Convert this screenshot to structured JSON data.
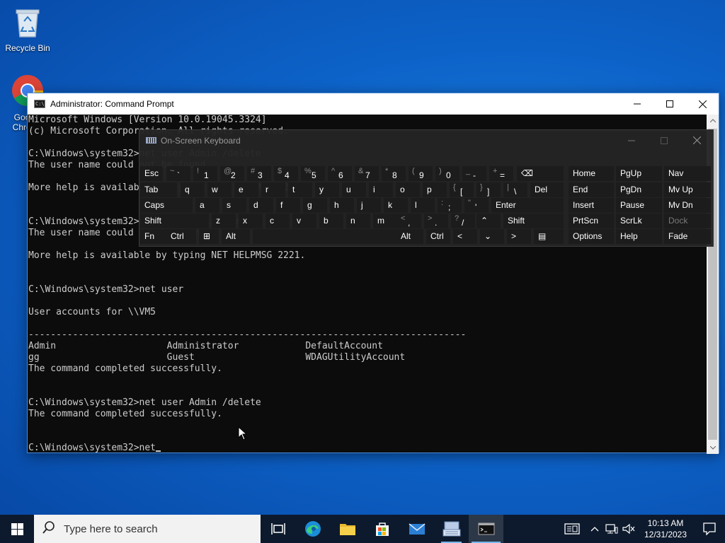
{
  "desktop": {
    "icons": [
      {
        "label": "Recycle Bin"
      },
      {
        "label": "Google Chrome"
      }
    ]
  },
  "cmd": {
    "title": "Administrator: Command Prompt",
    "lines": [
      "Microsoft Windows [Version 10.0.19045.3324]",
      "(c) Microsoft Corporation. All rights reserved.",
      "",
      "C:\\Windows\\system32>net user Admin /delete",
      "The user name could not be found.",
      "",
      "More help is available by typing NET HELPMSG 2221.",
      "",
      "",
      "C:\\Windows\\system32>net user Admin /delete",
      "The user name could not be found.",
      "",
      "More help is available by typing NET HELPMSG 2221.",
      "",
      "",
      "C:\\Windows\\system32>net user",
      "",
      "User accounts for \\\\VM5",
      "",
      "-------------------------------------------------------------------------------",
      "Admin                    Administrator            DefaultAccount",
      "gg                       Guest                    WDAGUtilityAccount",
      "The command completed successfully.",
      "",
      "",
      "C:\\Windows\\system32>net user Admin /delete",
      "The command completed successfully.",
      "",
      "",
      "C:\\Windows\\system32>net"
    ]
  },
  "osk": {
    "title": "On-Screen Keyboard",
    "row1": [
      {
        "label": "Esc"
      },
      {
        "top": "~",
        "bot": "`"
      },
      {
        "top": "!",
        "bot": "1"
      },
      {
        "top": "@",
        "bot": "2"
      },
      {
        "top": "#",
        "bot": "3"
      },
      {
        "top": "$",
        "bot": "4"
      },
      {
        "top": "%",
        "bot": "5"
      },
      {
        "top": "^",
        "bot": "6"
      },
      {
        "top": "&",
        "bot": "7"
      },
      {
        "top": "*",
        "bot": "8"
      },
      {
        "top": "(",
        "bot": "9"
      },
      {
        "top": ")",
        "bot": "0"
      },
      {
        "top": "_",
        "bot": "-"
      },
      {
        "top": "+",
        "bot": "="
      },
      {
        "label": "⌫"
      }
    ],
    "row2": [
      {
        "label": "Tab"
      },
      {
        "label": "q"
      },
      {
        "label": "w"
      },
      {
        "label": "e"
      },
      {
        "label": "r"
      },
      {
        "label": "t"
      },
      {
        "label": "y"
      },
      {
        "label": "u"
      },
      {
        "label": "i"
      },
      {
        "label": "o"
      },
      {
        "label": "p"
      },
      {
        "top": "{",
        "bot": "["
      },
      {
        "top": "}",
        "bot": "]"
      },
      {
        "top": "|",
        "bot": "\\"
      },
      {
        "label": "Del"
      }
    ],
    "row3": [
      {
        "label": "Caps"
      },
      {
        "label": "a"
      },
      {
        "label": "s"
      },
      {
        "label": "d"
      },
      {
        "label": "f"
      },
      {
        "label": "g"
      },
      {
        "label": "h"
      },
      {
        "label": "j"
      },
      {
        "label": "k"
      },
      {
        "label": "l"
      },
      {
        "top": ":",
        "bot": ";"
      },
      {
        "top": "\"",
        "bot": "'"
      },
      {
        "label": "Enter"
      }
    ],
    "row4": [
      {
        "label": "Shift"
      },
      {
        "label": "z"
      },
      {
        "label": "x"
      },
      {
        "label": "c"
      },
      {
        "label": "v"
      },
      {
        "label": "b"
      },
      {
        "label": "n"
      },
      {
        "label": "m"
      },
      {
        "top": "<",
        "bot": ","
      },
      {
        "top": ">",
        "bot": "."
      },
      {
        "top": "?",
        "bot": "/"
      },
      {
        "label": "⌃"
      },
      {
        "label": "Shift"
      }
    ],
    "row5": [
      {
        "label": "Fn"
      },
      {
        "label": "Ctrl"
      },
      {
        "label": "⊞"
      },
      {
        "label": "Alt"
      },
      {
        "label": ""
      },
      {
        "label": "Alt"
      },
      {
        "label": "Ctrl"
      },
      {
        "label": "<"
      },
      {
        "label": "⌄"
      },
      {
        "label": ">"
      },
      {
        "label": "▤"
      }
    ],
    "right_keys": [
      [
        "Home",
        "PgUp",
        "Nav"
      ],
      [
        "End",
        "PgDn",
        "Mv Up"
      ],
      [
        "Insert",
        "Pause",
        "Mv Dn"
      ],
      [
        "PrtScn",
        "ScrLk",
        "Dock"
      ],
      [
        "Options",
        "Help",
        "Fade"
      ]
    ]
  },
  "taskbar": {
    "search_placeholder": "Type here to search",
    "time": "10:13 AM",
    "date": "12/31/2023"
  }
}
